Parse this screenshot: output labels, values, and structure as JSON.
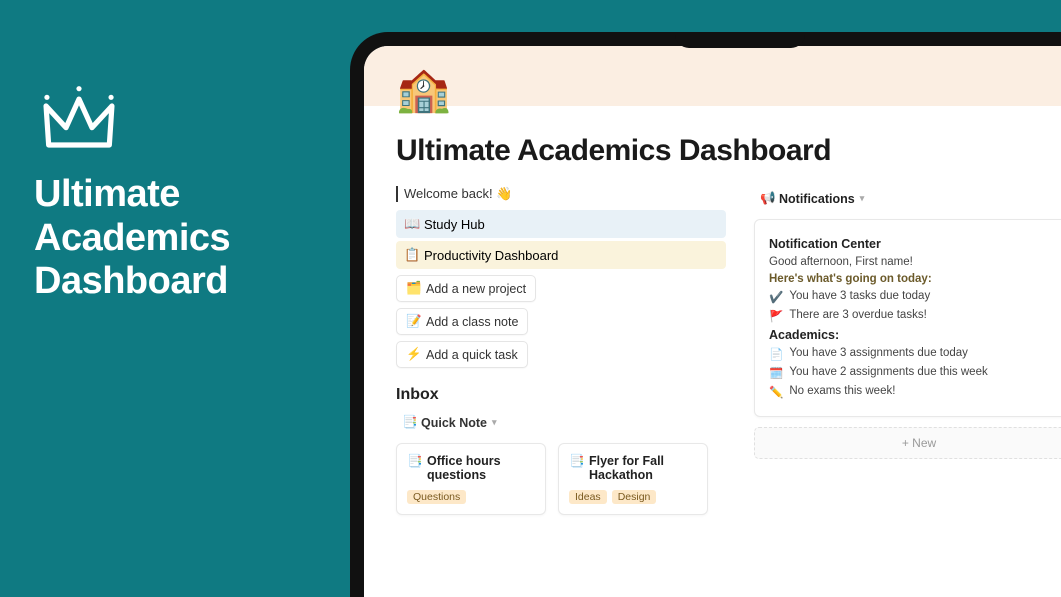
{
  "promo": {
    "title_line1": "Ultimate",
    "title_line2": "Academics",
    "title_line3": "Dashboard"
  },
  "page": {
    "icon": "🏫",
    "title": "Ultimate Academics Dashboard"
  },
  "welcome": {
    "text": "Welcome back! 👋"
  },
  "nav": {
    "study": {
      "icon": "📖",
      "label": "Study Hub"
    },
    "productivity": {
      "icon": "📋",
      "label": "Productivity Dashboard"
    }
  },
  "actions": {
    "project": {
      "icon": "🗂️",
      "label": "Add a new project"
    },
    "note": {
      "icon": "📝",
      "label": "Add a class note"
    },
    "task": {
      "icon": "⚡",
      "label": "Add a quick task"
    }
  },
  "inbox": {
    "heading": "Inbox",
    "quicknote": {
      "icon": "📑",
      "label": "Quick Note"
    },
    "cards": [
      {
        "icon": "📑",
        "title": "Office hours questions",
        "tags": [
          "Questions"
        ]
      },
      {
        "icon": "📑",
        "title": "Flyer for Fall Hackathon",
        "tags": [
          "Ideas",
          "Design"
        ]
      }
    ]
  },
  "notifications": {
    "header": {
      "icon": "📢",
      "label": "Notifications"
    },
    "center_title": "Notification Center",
    "greeting": "Good afternoon, First name!",
    "today_heading": "Here's what's going on today:",
    "today": [
      {
        "icon": "✔️",
        "text": "You have 3 tasks due today"
      },
      {
        "icon": "🚩",
        "text": "There are 3 overdue tasks!"
      }
    ],
    "academics_heading": "Academics:",
    "academics": [
      {
        "icon": "📄",
        "text": "You have 3 assignments due today"
      },
      {
        "icon": "🗓️",
        "text": "You have 2 assignments due this week"
      },
      {
        "icon": "✏️",
        "text": "No exams this week!"
      }
    ],
    "new_button": "+  New"
  }
}
